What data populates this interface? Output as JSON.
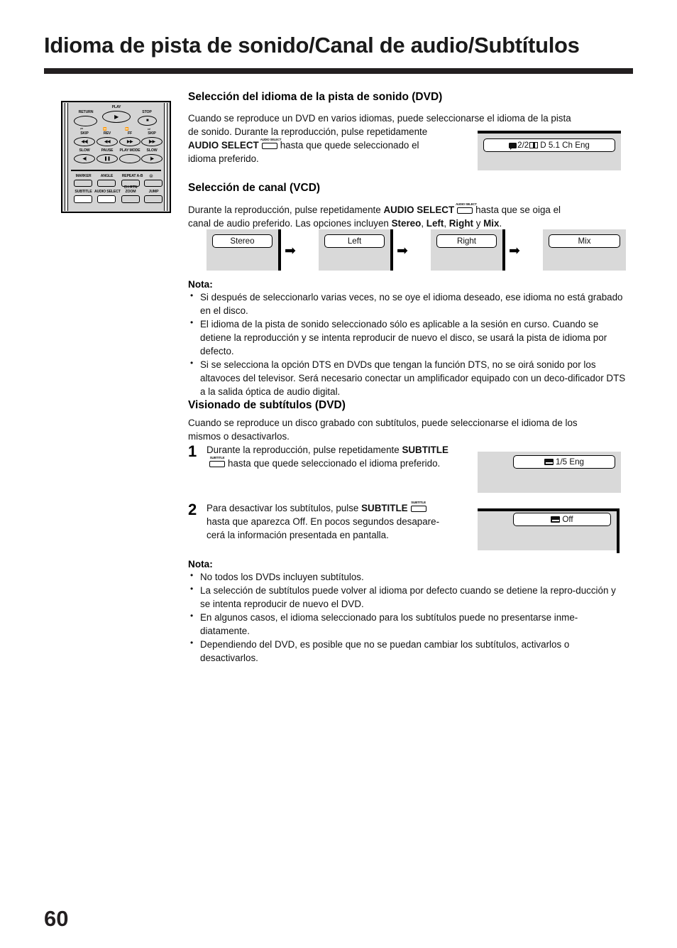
{
  "page": {
    "title": "Idioma de pista de sonido/Canal de audio/Subtítulos",
    "number": "60"
  },
  "remote": {
    "labels": {
      "return": "RETURN",
      "play": "PLAY",
      "stop": "STOP",
      "skip_back": "SKIP",
      "rev": "REV",
      "ff": "FF",
      "skip_fwd": "SKIP",
      "slow_back": "SLOW",
      "pause": "PAUSE",
      "play_mode": "PLAY MODE",
      "slow_fwd": "SLOW",
      "marker": "MARKER",
      "angle": "ANGLE",
      "repeat_ab": "REPEAT A-B",
      "subtitle": "SUBTITLE",
      "audio_select": "AUDIO SELECT",
      "ch_rtn_zoom": "CH RTN\nZOOM",
      "jump": "JUMP"
    },
    "glyphs": {
      "play": "▶",
      "stop": "■",
      "skip_back": "◀◀|",
      "rev": "◀◀",
      "ff": "▶▶",
      "skip_fwd": "|▶▶",
      "slow_back": "◀|",
      "pause": "❚❚",
      "slow_fwd": "|▶"
    }
  },
  "section_audio": {
    "heading": "Selección del idioma de la pista de sonido (DVD)",
    "para_1": "Cuando se reproduce un DVD en varios idiomas, puede seleccionarse el idioma de la pista",
    "para_2": "de sonido. Durante la reproducción, pulse repetidamente",
    "para_3_bold": "AUDIO SELECT",
    "key_label": "AUDIO SELECT",
    "para_4": "hasta que quede seleccionado el",
    "para_5": "idioma preferido.",
    "osd": {
      "count": "2/2",
      "text": "D 5.1 Ch Eng"
    }
  },
  "section_vcd": {
    "heading": "Selección de canal (VCD)",
    "para_a": "Durante la reproducción, pulse repetidamente",
    "para_a_bold": "AUDIO SELECT",
    "key_label": "AUDIO SELECT",
    "para_b": "hasta que se oiga el",
    "para_c_pre": "canal de audio preferido. Las opciones incluyen",
    "options_bold": [
      "Stereo",
      "Left",
      "Right",
      "Mix"
    ],
    "conj": "y",
    "period": ".",
    "flow": {
      "cells": [
        "Stereo",
        "Left",
        "Right",
        "Mix"
      ],
      "arrow": "➡"
    }
  },
  "note_audio": {
    "title": "Nota:",
    "items": [
      "Si después de seleccionarlo varias veces, no se oye el idioma deseado, ese idioma no está grabado en el disco.",
      "El idioma de la pista de sonido seleccionado sólo es aplicable a la sesión en curso. Cuando se detiene la reproducción y se intenta reproducir de nuevo el disco, se usará la pista de idioma por defecto.",
      "Si se selecciona la opción DTS en DVDs que tengan la función DTS, no se oirá sonido por los altavoces del televisor. Será necesario conectar un amplificador equipado con un deco-dificador DTS a la salida óptica de audio digital."
    ]
  },
  "section_subs": {
    "heading": "Visionado de subtítulos (DVD)",
    "intro_1": "Cuando se reproduce un disco grabado con subtítulos, puede seleccionarse el idioma de los",
    "intro_2": "mismos o desactivarlos.",
    "step1": {
      "number": "1",
      "text_a": "Durante la reproducción, pulse repetidamente",
      "text_a_bold": "SUBTITLE",
      "key_label": "SUBTITLE",
      "text_b": "hasta que quede seleccionado el idioma preferido.",
      "osd": "1/5 Eng"
    },
    "step2": {
      "number": "2",
      "text_a": "Para desactivar los subtítulos, pulse",
      "text_a_bold": "SUBTITLE",
      "key_label": "SUBTITLE",
      "text_b": "hasta que aparezca Off. En pocos segundos desapare-",
      "text_c": "cerá la información presentada en pantalla.",
      "osd": "Off"
    }
  },
  "note_subs": {
    "title": "Nota:",
    "items": [
      "No todos los DVDs incluyen subtítulos.",
      "La selección de subtítulos puede volver al idioma por defecto cuando se detiene la repro-ducción y se intenta reproducir de nuevo el DVD.",
      "En algunos casos, el idioma seleccionado para los subtítulos puede no presentarse inme-diatamente.",
      "Dependiendo del DVD, es posible que no se puedan cambiar los subtítulos, activarlos o desactivarlos."
    ]
  },
  "colors": {
    "ink": "#231f20",
    "panel": "#d9d9d9",
    "remote_body": "#d4d4d4"
  }
}
